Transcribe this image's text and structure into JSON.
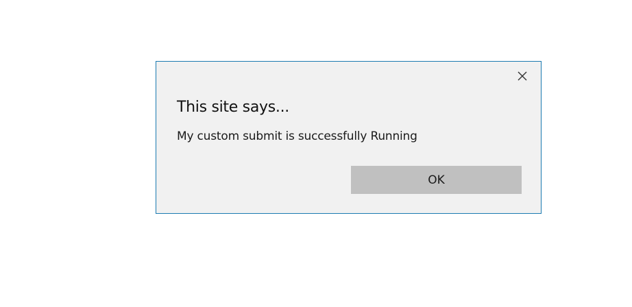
{
  "dialog": {
    "title": "This site says...",
    "message": "My custom submit is successfully Running",
    "ok_label": "OK",
    "close_icon": "close-icon"
  },
  "colors": {
    "page_background": "#ffffff",
    "dialog_background": "#f1f1f1",
    "dialog_border": "#1a7ab1",
    "ok_button_background": "#c0c0c0"
  }
}
